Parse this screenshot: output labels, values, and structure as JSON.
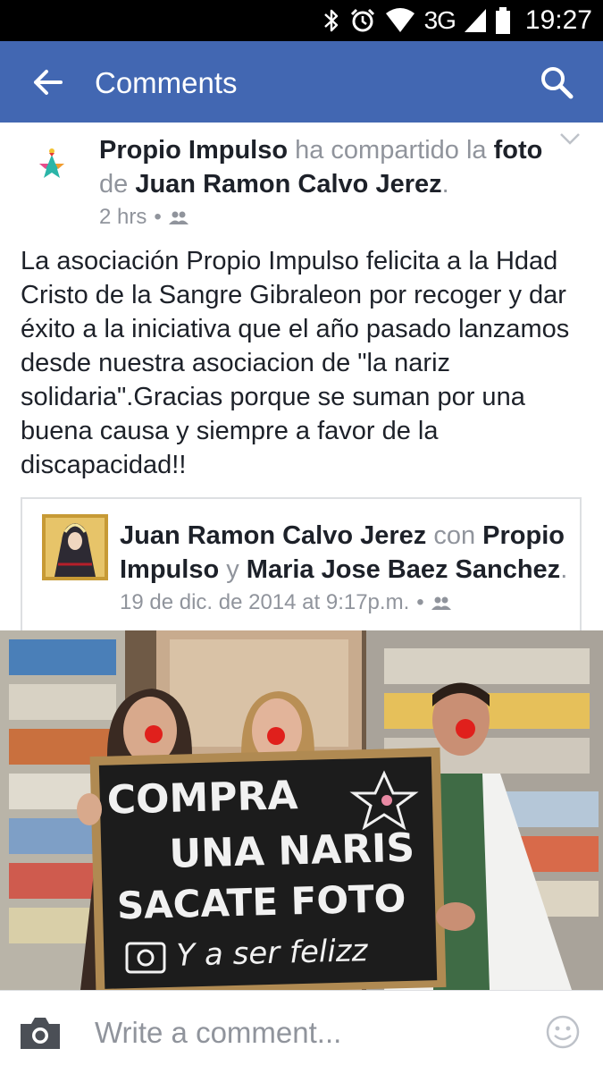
{
  "status": {
    "network": "3G",
    "time": "19:27"
  },
  "appbar": {
    "title": "Comments"
  },
  "post": {
    "author": "Propio Impulso",
    "shared_text": " ha compartido la ",
    "photo_word": "foto",
    "of_text": " de ",
    "original_author": "Juan Ramon Calvo Jerez",
    "period": ".",
    "time": "2 hrs",
    "dot": "•",
    "message": "La asociación Propio Impulso felicita a la Hdad Cristo de la Sangre Gibraleon por recoger y dar éxito a la iniciativa que el año pasado lanzamos desde nuestra asociacion de \"la nariz solidaria\".Gracias porque se suman por una buena causa y siempre a favor de la discapacidad!!"
  },
  "shared_post": {
    "author": "Juan Ramon Calvo Jerez",
    "with_text": " con ",
    "tag1": "Propio Impulso",
    "and_text": " y ",
    "tag2": "Maria Jose Baez Sanchez",
    "period": ".",
    "date": "19 de dic. de 2014 at 9:17p.m.",
    "dot": "•"
  },
  "photo": {
    "sign_line1": "COMPRA",
    "sign_line2": "UNA NARIS",
    "sign_line3": "SACATE FOTO",
    "sign_line4": "Y a ser felizz"
  },
  "composer": {
    "placeholder": "Write a comment..."
  },
  "colors": {
    "brand": "#4267b2",
    "text": "#1d2129",
    "meta": "#90949c",
    "border": "#dddfe2"
  },
  "icons": [
    "bluetooth-icon",
    "alarm-icon",
    "wifi-icon",
    "signal-icon",
    "battery-icon",
    "back-arrow-icon",
    "search-icon",
    "chevron-down-icon",
    "friends-icon",
    "camera-icon",
    "smiley-icon"
  ]
}
